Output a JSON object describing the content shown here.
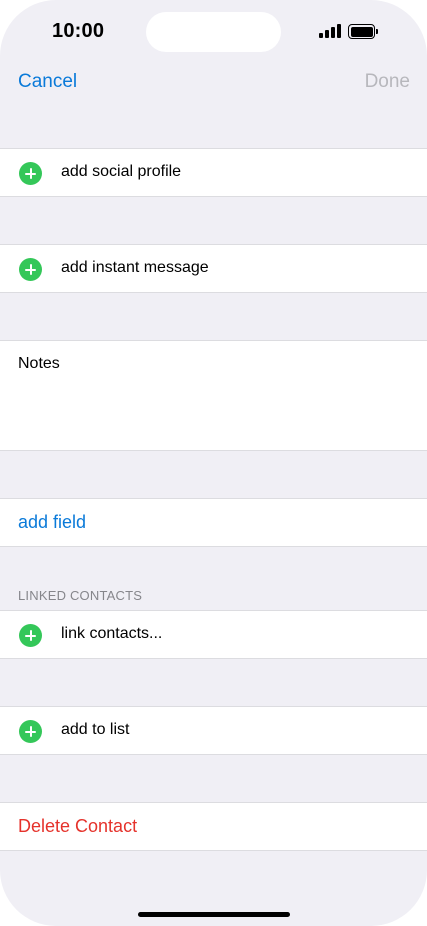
{
  "status_bar": {
    "time": "10:00"
  },
  "nav": {
    "cancel_label": "Cancel",
    "done_label": "Done"
  },
  "rows": {
    "social_profile": "add social profile",
    "instant_message": "add instant message",
    "notes": "Notes",
    "add_field": "add field",
    "linked_header": "LINKED CONTACTS",
    "link_contacts": "link contacts...",
    "add_to_list": "add to list",
    "delete_contact": "Delete Contact"
  },
  "colors": {
    "accent_blue": "#0a7ad9",
    "add_green": "#34c759",
    "destructive_red": "#e5322b",
    "background_gray": "#f0eff5"
  },
  "icons": [
    "add-circle-icon",
    "cellular-signal-icon",
    "battery-icon"
  ]
}
